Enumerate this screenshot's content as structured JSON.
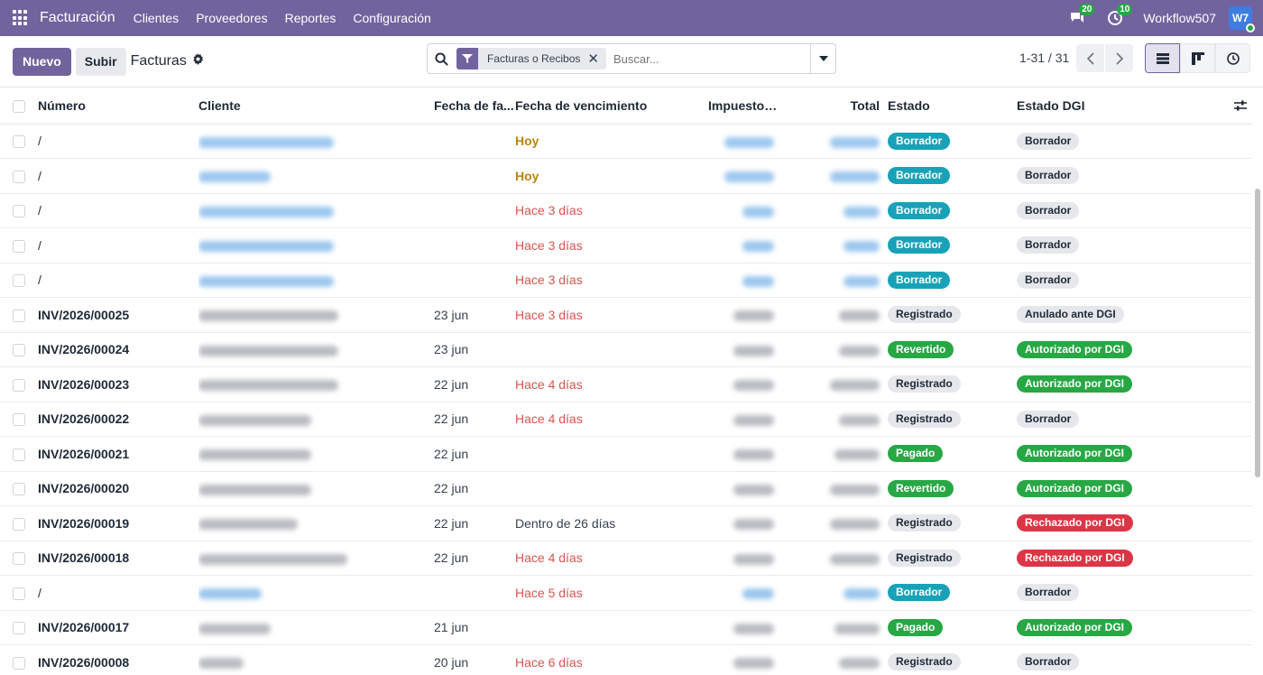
{
  "navbar": {
    "brand": "Facturación",
    "menu": [
      "Clientes",
      "Proveedores",
      "Reportes",
      "Configuración"
    ],
    "messages_count": "20",
    "activities_count": "10",
    "company": "Workflow507",
    "avatar_initials": "W7"
  },
  "control": {
    "new_label": "Nuevo",
    "upload_label": "Subir",
    "title": "Facturas",
    "facet_label": "Facturas o Recibos",
    "search_placeholder": "Buscar...",
    "pager": "1-31 / 31"
  },
  "table": {
    "headers": {
      "numero": "Número",
      "cliente": "Cliente",
      "fecha": "Fecha de fa...",
      "vencimiento": "Fecha de vencimiento",
      "impuestos": "Impuestos no ...",
      "total": "Total",
      "estado": "Estado",
      "estado_dgi": "Estado DGI"
    },
    "rows": [
      {
        "numero": "/",
        "fecha": "",
        "venc": "Hoy",
        "venc_type": "today",
        "estado": "Borrador",
        "estado_type": "info",
        "dgi": "Borrador",
        "dgi_type": "gray",
        "client_link": true
      },
      {
        "numero": "/",
        "fecha": "",
        "venc": "Hoy",
        "venc_type": "today",
        "estado": "Borrador",
        "estado_type": "info",
        "dgi": "Borrador",
        "dgi_type": "gray",
        "client_link": true
      },
      {
        "numero": "/",
        "fecha": "",
        "venc": "Hace 3 días",
        "venc_type": "late",
        "estado": "Borrador",
        "estado_type": "info",
        "dgi": "Borrador",
        "dgi_type": "gray",
        "client_link": true
      },
      {
        "numero": "/",
        "fecha": "",
        "venc": "Hace 3 días",
        "venc_type": "late",
        "estado": "Borrador",
        "estado_type": "info",
        "dgi": "Borrador",
        "dgi_type": "gray",
        "client_link": true
      },
      {
        "numero": "/",
        "fecha": "",
        "venc": "Hace 3 días",
        "venc_type": "late",
        "estado": "Borrador",
        "estado_type": "info",
        "dgi": "Borrador",
        "dgi_type": "gray",
        "client_link": true
      },
      {
        "numero": "INV/2026/00025",
        "fecha": "23 jun",
        "venc": "Hace 3 días",
        "venc_type": "late",
        "estado": "Registrado",
        "estado_type": "gray",
        "dgi": "Anulado ante DGI",
        "dgi_type": "gray",
        "client_link": false
      },
      {
        "numero": "INV/2026/00024",
        "fecha": "23 jun",
        "venc": "",
        "venc_type": "ok",
        "estado": "Revertido",
        "estado_type": "green",
        "dgi": "Autorizado por DGI",
        "dgi_type": "green",
        "client_link": false
      },
      {
        "numero": "INV/2026/00023",
        "fecha": "22 jun",
        "venc": "Hace 4 días",
        "venc_type": "late",
        "estado": "Registrado",
        "estado_type": "gray",
        "dgi": "Autorizado por DGI",
        "dgi_type": "green",
        "client_link": false
      },
      {
        "numero": "INV/2026/00022",
        "fecha": "22 jun",
        "venc": "Hace 4 días",
        "venc_type": "late",
        "estado": "Registrado",
        "estado_type": "gray",
        "dgi": "Borrador",
        "dgi_type": "gray",
        "client_link": false
      },
      {
        "numero": "INV/2026/00021",
        "fecha": "22 jun",
        "venc": "",
        "venc_type": "ok",
        "estado": "Pagado",
        "estado_type": "green",
        "dgi": "Autorizado por DGI",
        "dgi_type": "green",
        "client_link": false
      },
      {
        "numero": "INV/2026/00020",
        "fecha": "22 jun",
        "venc": "",
        "venc_type": "ok",
        "estado": "Revertido",
        "estado_type": "green",
        "dgi": "Autorizado por DGI",
        "dgi_type": "green",
        "client_link": false
      },
      {
        "numero": "INV/2026/00019",
        "fecha": "22 jun",
        "venc": "Dentro de 26 días",
        "venc_type": "ok",
        "estado": "Registrado",
        "estado_type": "gray",
        "dgi": "Rechazado por DGI",
        "dgi_type": "red",
        "client_link": false
      },
      {
        "numero": "INV/2026/00018",
        "fecha": "22 jun",
        "venc": "Hace 4 días",
        "venc_type": "late",
        "estado": "Registrado",
        "estado_type": "gray",
        "dgi": "Rechazado por DGI",
        "dgi_type": "red",
        "client_link": false
      },
      {
        "numero": "/",
        "fecha": "",
        "venc": "Hace 5 días",
        "venc_type": "late",
        "estado": "Borrador",
        "estado_type": "info",
        "dgi": "Borrador",
        "dgi_type": "gray",
        "client_link": true
      },
      {
        "numero": "INV/2026/00017",
        "fecha": "21 jun",
        "venc": "",
        "venc_type": "ok",
        "estado": "Pagado",
        "estado_type": "green",
        "dgi": "Autorizado por DGI",
        "dgi_type": "green",
        "client_link": false
      },
      {
        "numero": "INV/2026/00008",
        "fecha": "20 jun",
        "venc": "Hace 6 días",
        "venc_type": "late",
        "estado": "Registrado",
        "estado_type": "gray",
        "dgi": "Borrador",
        "dgi_type": "gray",
        "client_link": false
      }
    ]
  },
  "colors": {
    "brand": "#71639e",
    "draft": "#17a2b8",
    "success": "#28a745",
    "danger": "#dc3545"
  }
}
